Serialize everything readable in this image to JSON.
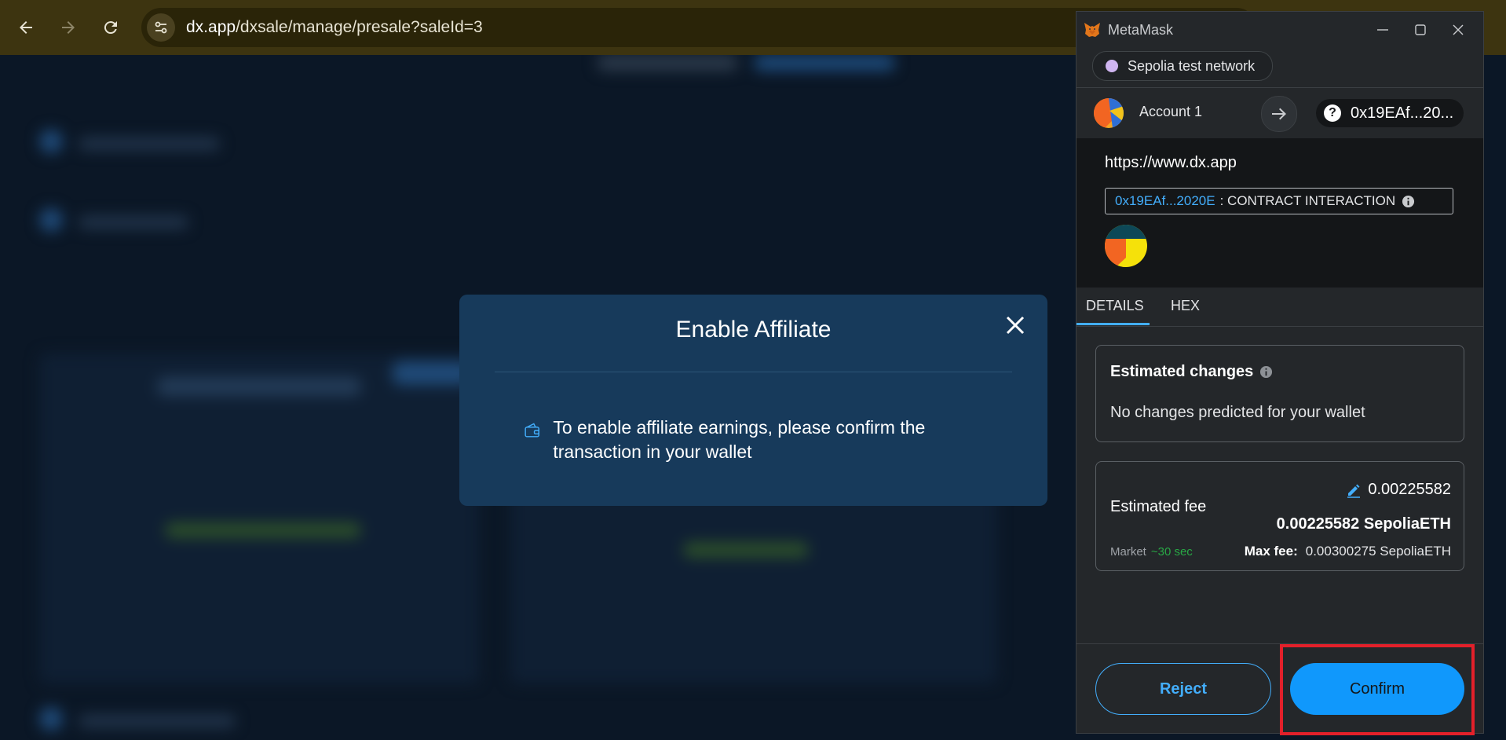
{
  "browser": {
    "url_host": "dx.app",
    "url_path": "/dxsale/manage/presale?saleId=3"
  },
  "modal": {
    "title": "Enable Affiliate",
    "message": "To enable affiliate earnings, please confirm the transaction in your wallet"
  },
  "metamask": {
    "window_title": "MetaMask",
    "network": "Sepolia test network",
    "account_name": "Account 1",
    "to_address": "0x19EAf...20...",
    "origin": "https://www.dx.app",
    "contract_address": "0x19EAf...2020E",
    "contract_type": ": CONTRACT INTERACTION",
    "tabs": [
      "DETAILS",
      "HEX"
    ],
    "estimated_changes": {
      "title": "Estimated changes",
      "text": "No changes predicted for your wallet"
    },
    "fee": {
      "label": "Estimated fee",
      "amount": "0.00225582",
      "amount_bold": "0.00225582 SepoliaETH",
      "market": "Market",
      "time": "~30 sec",
      "max_label": "Max fee:",
      "max_value": "0.00300275 SepoliaETH"
    },
    "reject_label": "Reject",
    "confirm_label": "Confirm"
  },
  "colors": {
    "accent": "#43aefc",
    "confirm_bg": "#1098fc",
    "highlight": "#e3202a",
    "modal_bg": "#173a5b"
  }
}
